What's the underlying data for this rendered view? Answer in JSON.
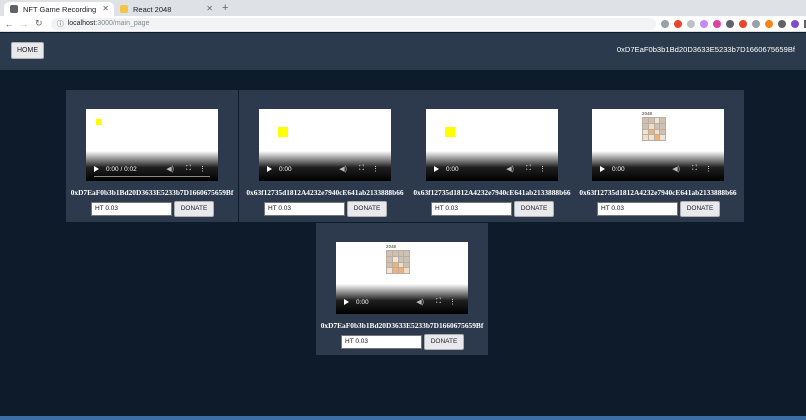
{
  "browser": {
    "tabs": [
      {
        "title": "NFT Game Recording",
        "favicon_color": "#5f6368",
        "active": true
      },
      {
        "title": "React 2048",
        "favicon_color": "#f4c542",
        "active": false
      }
    ],
    "url_host": "localhost",
    "url_rest": ":3000/main_page"
  },
  "header": {
    "home_label": "HOME",
    "account": "0xD7EaF0b3b1Bd20D3633E5233b7D1660675659Bf"
  },
  "videos": [
    {
      "address": "0xD7EaF0b3b1Bd20D3633E5233b7D1660675659Bf",
      "time": "0:00 / 0:02",
      "amount": "HT 0.03",
      "donate_label": "DONATE",
      "thumbnail": "small-yellow-square"
    },
    {
      "address": "0x63f12735d1812A4232e7940cE641ab2133888b66",
      "time": "0:00",
      "amount": "HT 0.03",
      "donate_label": "DONATE",
      "thumbnail": "yellow-square"
    },
    {
      "address": "0x63f12735d1812A4232e7940cE641ab2133888b66",
      "time": "0:00",
      "amount": "HT 0.03",
      "donate_label": "DONATE",
      "thumbnail": "yellow-square"
    },
    {
      "address": "0x63f12735d1812A4232e7940cE641ab2133888b66",
      "time": "0:00",
      "amount": "HT 0.03",
      "donate_label": "DONATE",
      "thumbnail": "2048-game"
    },
    {
      "address": "0xD7EaF0b3b1Bd20D3633E5233b7D1660675659Bf",
      "time": "0:00",
      "amount": "HT 0.03",
      "donate_label": "DONATE",
      "thumbnail": "2048-game"
    }
  ],
  "game_title": "2048",
  "colors": {
    "appbar": "#2b3a4c",
    "background": "#0d1b2a",
    "card": "#2d3a4d",
    "thumb_square": "#ffff00"
  }
}
